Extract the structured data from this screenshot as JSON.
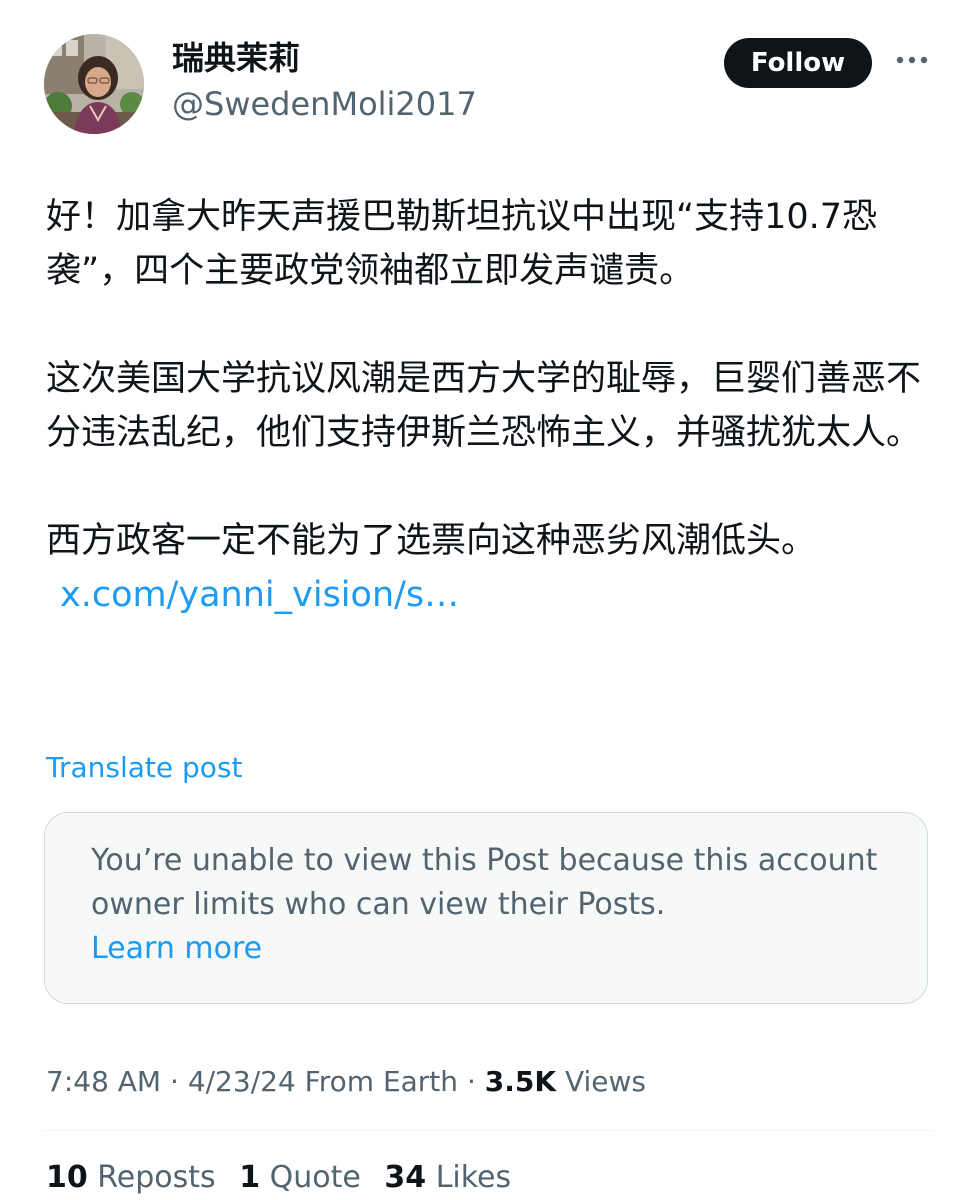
{
  "author": {
    "display_name": "瑞典茉莉",
    "handle": "@SwedenMoli2017",
    "follow_label": "Follow",
    "more_icon": "more-horizontal-icon"
  },
  "post": {
    "paragraphs": [
      "好！加拿大昨天声援巴勒斯坦抗议中出现“支持10.7恐袭”，四个主要政党领袖都立即发声谴责。",
      "这次美国大学抗议风潮是西方大学的耻辱，巨婴们善恶不分违法乱纪，他们支持伊斯兰恐怖主义，并骚扰犹太人。",
      "西方政客一定不能为了选票向这种恶劣风潮低头。"
    ],
    "link_text": "x.com/yanni_vision/s…",
    "translate_label": "Translate post"
  },
  "quoted_notice": {
    "message": "You’re unable to view this Post because this account owner limits who can view their Posts.",
    "learn_more": "Learn more"
  },
  "meta": {
    "time": "7:48 AM",
    "date": "4/23/24",
    "source": "From Earth",
    "views_count": "3.5K",
    "views_label": "Views",
    "separator": "·"
  },
  "stats": {
    "reposts_count": "10",
    "reposts_label": "Reposts",
    "quotes_count": "1",
    "quotes_label": "Quote",
    "likes_count": "34",
    "likes_label": "Likes"
  },
  "colors": {
    "text_primary": "#0f1419",
    "text_secondary": "#536471",
    "link": "#1d9bf0",
    "button_bg": "#0f1419",
    "notice_bg": "#f7f9f9",
    "border": "#cfd9de"
  }
}
